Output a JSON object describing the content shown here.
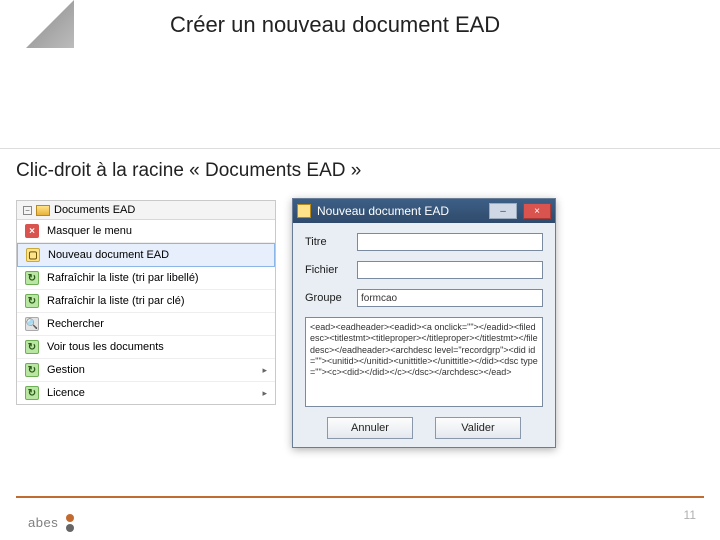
{
  "slide": {
    "title": "Créer un nouveau document EAD",
    "instruction": "Clic-droit à la racine « Documents EAD »",
    "page_number": "11",
    "footer_brand": "abes"
  },
  "tree": {
    "root_label": "Documents EAD",
    "collapse_symbol": "−"
  },
  "context_menu": {
    "items": [
      {
        "icon": "close-icon",
        "icon_class": "ic-red",
        "label": "Masquer le menu",
        "has_submenu": false
      },
      {
        "icon": "new-doc-icon",
        "icon_class": "ic-yellow",
        "label": "Nouveau document EAD",
        "has_submenu": false,
        "highlight": true
      },
      {
        "icon": "refresh-icon",
        "icon_class": "ic-green",
        "label": "Rafraîchir la liste (tri par libellé)",
        "has_submenu": false
      },
      {
        "icon": "refresh-icon",
        "icon_class": "ic-green",
        "label": "Rafraîchir la liste (tri par clé)",
        "has_submenu": false
      },
      {
        "icon": "search-icon",
        "icon_class": "ic-grey",
        "label": "Rechercher",
        "has_submenu": false
      },
      {
        "icon": "list-icon",
        "icon_class": "ic-green",
        "label": "Voir tous les documents",
        "has_submenu": false
      },
      {
        "icon": "manage-icon",
        "icon_class": "ic-green",
        "label": "Gestion",
        "has_submenu": true
      },
      {
        "icon": "license-icon",
        "icon_class": "ic-green",
        "label": "Licence",
        "has_submenu": true
      }
    ],
    "submenu_arrow": "▸"
  },
  "dialog": {
    "title": "Nouveau document EAD",
    "minimize": "–",
    "close": "×",
    "labels": {
      "titre": "Titre",
      "fichier": "Fichier",
      "groupe": "Groupe"
    },
    "values": {
      "titre": "",
      "fichier": "",
      "groupe": "formcao"
    },
    "code_preview": "<ead><eadheader><eadid><a onclick=\"\"></eadid><filedesc><titlestmt><titleproper></titleproper></titlestmt></filedesc></eadheader><archdesc level=\"recordgrp\"><did id=\"\"><unitid></unitid><unittitle></unittitle></did><dsc type=\"\"><c><did></did></c></dsc></archdesc></ead>",
    "buttons": {
      "cancel": "Annuler",
      "ok": "Valider"
    }
  }
}
